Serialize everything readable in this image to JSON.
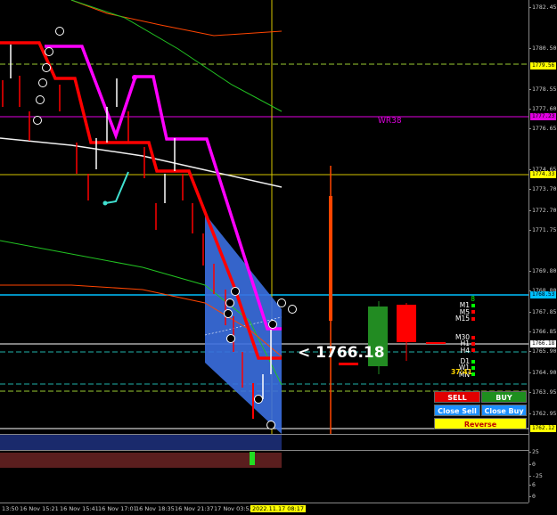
{
  "price_axis": {
    "ticks": [
      "1782.45",
      "1780.50",
      "1778.55",
      "1777.60",
      "1776.65",
      "1774.65",
      "1773.70",
      "1772.70",
      "1771.75",
      "1769.80",
      "1768.80",
      "1767.85",
      "1766.85",
      "1765.90",
      "1764.90",
      "1763.95",
      "1762.95"
    ],
    "labels": [
      {
        "text": "1779.56",
        "bg": "#ffff00",
        "fg": "#000000"
      },
      {
        "text": "1777.23",
        "bg": "#e000e0",
        "fg": "#000000"
      },
      {
        "text": "1774.33",
        "bg": "#ffff00",
        "fg": "#000000"
      },
      {
        "text": "1768.53",
        "bg": "#00bfff",
        "fg": "#000000"
      },
      {
        "text": "1766.18",
        "bg": "#ffffff",
        "fg": "#000000"
      },
      {
        "text": "1762.12",
        "bg": "#ffff00",
        "fg": "#000000"
      }
    ]
  },
  "sub_axis": {
    "ticks": [
      "25",
      "0",
      "-25",
      "6",
      "0"
    ]
  },
  "time_axis": {
    "ticks": [
      "13:50",
      "16 Nov 15:21",
      "16 Nov 15:41",
      "16 Nov 17:01",
      "16 Nov 18:35",
      "16 Nov 21:37",
      "17 Nov 03:52"
    ],
    "highlight": "2022.11.17 08:17"
  },
  "bid_display": "<  1766.18",
  "wr_label": "WR38",
  "timeframes": [
    {
      "label": "8",
      "color": "#00ff00"
    },
    {
      "label": "M1",
      "color": "#00ff00"
    },
    {
      "label": "M5",
      "color": "#ff0000"
    },
    {
      "label": "M15",
      "color": "#ff0000"
    },
    {
      "label": "M30",
      "color": "#ff0000"
    },
    {
      "label": "H1",
      "color": "#ff0000"
    },
    {
      "label": "H4",
      "color": "#ff0000"
    },
    {
      "label": "D1",
      "color": "#00ff00"
    },
    {
      "label": "W1",
      "color": "#00ff00"
    },
    {
      "label": "MN",
      "color": "#00ff00"
    }
  ],
  "timer": "37:41",
  "trade_panel": {
    "sell": "SELL",
    "buy": "BUY",
    "close_sell": "Close Sell",
    "close_buy": "Close Buy",
    "reverse": "Reverse"
  },
  "colors": {
    "bull": "#228b22",
    "bear": "#ff0000",
    "magenta": "#ff00ff",
    "cyan_line": "#00bfff",
    "yellow_line": "#d4c400",
    "channel": "#3b6fe0"
  }
}
